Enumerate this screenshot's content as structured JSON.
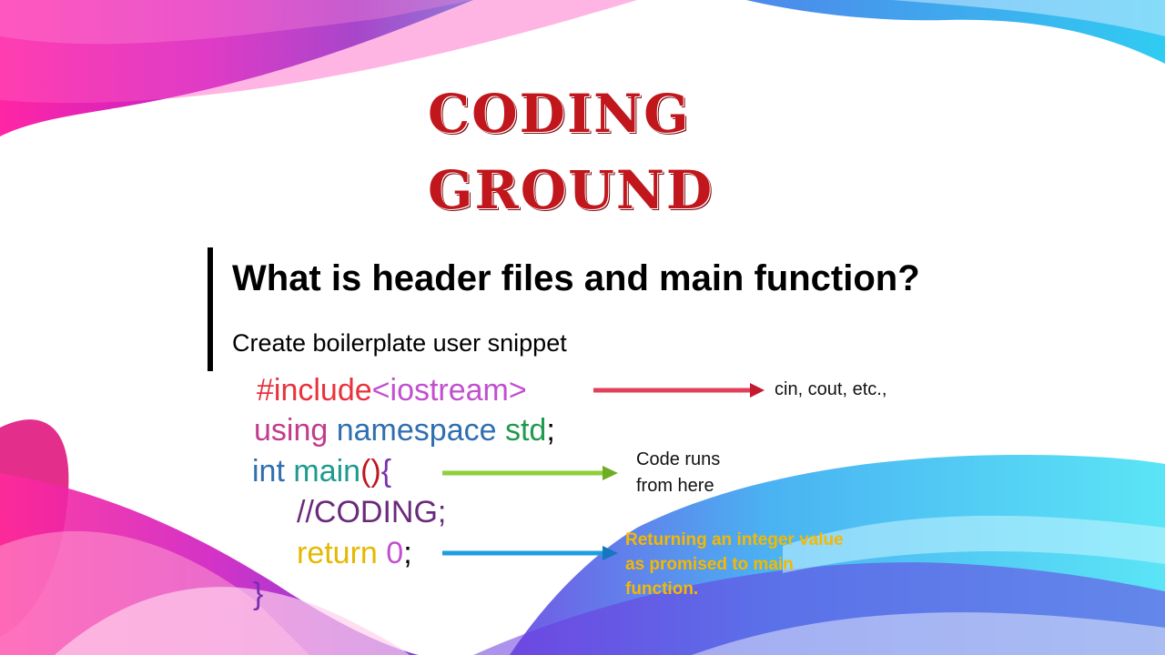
{
  "title": {
    "line1": "CODING",
    "line2": "GROUND"
  },
  "heading": "What is header files and main function?",
  "subtitle": "Create boilerplate user snippet",
  "code": {
    "include": {
      "directive": "#include",
      "header": "<iostream>"
    },
    "using": {
      "kw1": "using",
      "kw2": "namespace",
      "ns": "std",
      "semi": ";"
    },
    "main": {
      "type": "int",
      "name": "main",
      "parens": "()",
      "brace": "{"
    },
    "comment": "//CODING;",
    "ret": {
      "kw": "return",
      "val": "0",
      "semi": ";"
    },
    "close": "}"
  },
  "annotations": {
    "include_note": "cin, cout, etc.,",
    "main_note_line1": "Code runs",
    "main_note_line2": "from here",
    "return_note": "Returning an integer value as promised to main function."
  },
  "colors": {
    "title": "#c0161c",
    "include": "#e8323c",
    "header": "#c24fd0",
    "using": "#c23b8c",
    "namespace": "#2f6fb0",
    "std": "#1f9a4f",
    "int_main": "#2f6fb0",
    "parens": "#c0161c",
    "brace": "#7a2fb0",
    "comment": "#6a2a7a",
    "return": "#e6b800",
    "zero": "#c24fd0",
    "arrow_red": "#e0405a",
    "arrow_green": "#8ecf3a",
    "arrow_blue": "#1e9ee0",
    "note_yellow": "#f5b800"
  }
}
